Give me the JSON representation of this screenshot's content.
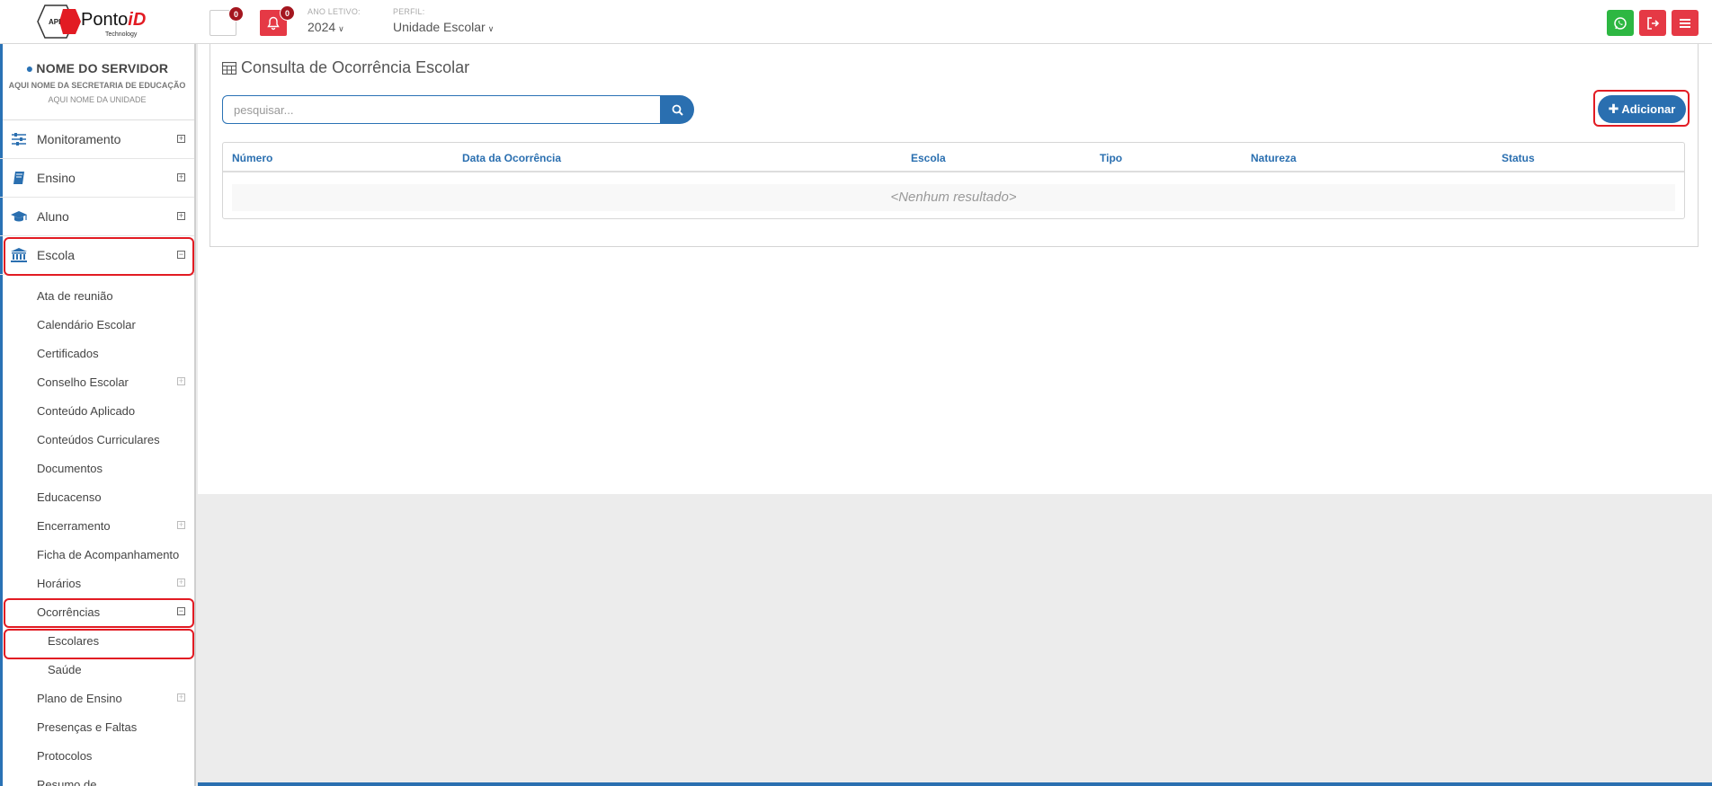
{
  "brand": {
    "logo_text": "PontoiD",
    "logo_sub": "Technology",
    "logo_mark": "API"
  },
  "topbar": {
    "menu_badge": "0",
    "notifications_badge": "0",
    "ano_letivo_label": "ANO LETIVO:",
    "ano_letivo_value": "2024",
    "perfil_label": "PERFIL:",
    "perfil_value": "Unidade Escolar"
  },
  "sidebar": {
    "server_name": "NOME DO SERVIDOR",
    "secretaria": "AQUI NOME DA SECRETARIA DE EDUCAÇÃO",
    "unidade": "AQUI NOME DA UNIDADE",
    "items": [
      {
        "label": "Monitoramento",
        "icon": "sliders-icon"
      },
      {
        "label": "Ensino",
        "icon": "book-icon"
      },
      {
        "label": "Aluno",
        "icon": "graduation-cap-icon"
      },
      {
        "label": "Escola",
        "icon": "institution-icon",
        "expanded": true
      }
    ],
    "escola_sub": [
      {
        "label": "Ata de reunião",
        "expandable": false
      },
      {
        "label": "Calendário Escolar",
        "expandable": false
      },
      {
        "label": "Certificados",
        "expandable": false
      },
      {
        "label": "Conselho Escolar",
        "expandable": true
      },
      {
        "label": "Conteúdo Aplicado",
        "expandable": false
      },
      {
        "label": "Conteúdos Curriculares",
        "expandable": false
      },
      {
        "label": "Documentos",
        "expandable": false
      },
      {
        "label": "Educacenso",
        "expandable": false
      },
      {
        "label": "Encerramento",
        "expandable": true
      },
      {
        "label": "Ficha de Acompanhamento",
        "expandable": false
      },
      {
        "label": "Horários",
        "expandable": true
      },
      {
        "label": "Ocorrências",
        "expandable": true,
        "expanded": true
      },
      {
        "label": "Escolares",
        "expandable": false,
        "level": 2
      },
      {
        "label": "Saúde",
        "expandable": false,
        "level": 2
      },
      {
        "label": "Plano de Ensino",
        "expandable": true
      },
      {
        "label": "Presenças e Faltas",
        "expandable": false
      },
      {
        "label": "Protocolos",
        "expandable": false
      },
      {
        "label": "Resumo de",
        "expandable": false
      }
    ]
  },
  "main": {
    "title": "Consulta de Ocorrência Escolar",
    "search_placeholder": "pesquisar...",
    "add_label": "Adicionar",
    "columns": [
      "Número",
      "Data da Ocorrência",
      "Escola",
      "Tipo",
      "Natureza",
      "Status"
    ],
    "empty_text": "<Nenhum resultado>"
  },
  "colors": {
    "primary": "#2a6fb0",
    "danger": "#e53945",
    "whatsapp": "#2db742",
    "highlight": "#e21b23"
  }
}
